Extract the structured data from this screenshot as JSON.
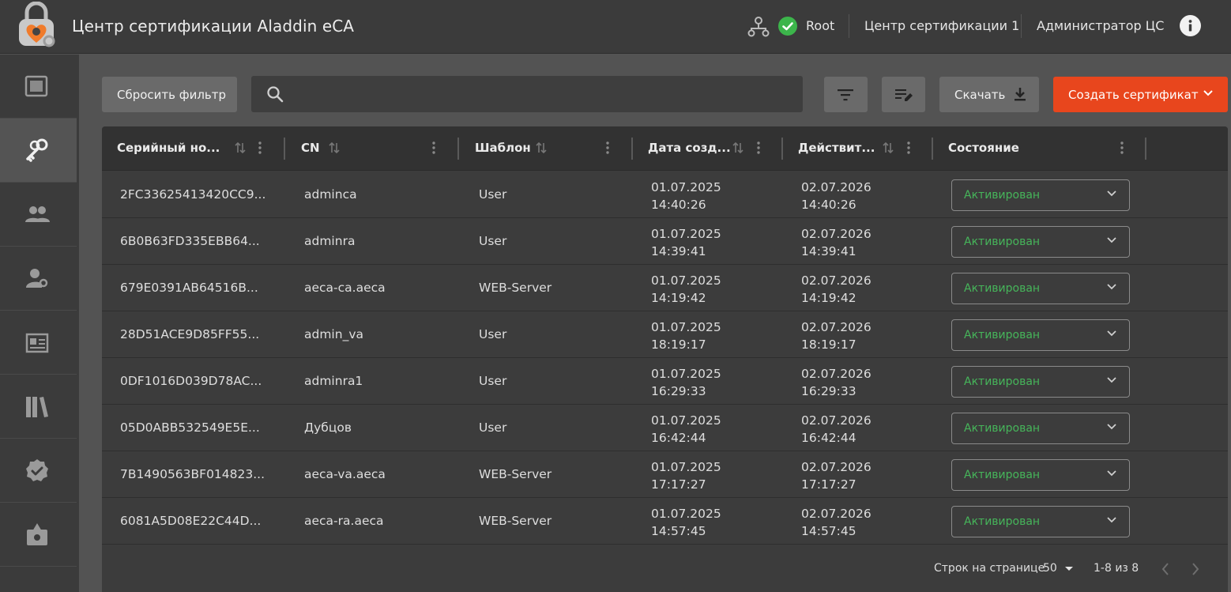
{
  "header": {
    "app_title": "Центр сертификации Aladdin eCA",
    "root_label": "Root",
    "ca_label": "Центр сертификации 1",
    "user_label": "Администратор ЦС"
  },
  "toolbar": {
    "reset_filter": "Сбросить фильтр",
    "search_placeholder": "",
    "download": "Скачать",
    "create_certificate": "Создать сертификат"
  },
  "table": {
    "columns": [
      "Серийный но...",
      "CN",
      "Шаблон",
      "Дата созд...",
      "Действит...",
      "Состояние"
    ],
    "rows": [
      {
        "serial": "2FC33625413420CC9...",
        "cn": "adminca",
        "template": "User",
        "created_date": "01.07.2025",
        "created_time": "14:40:26",
        "valid_date": "02.07.2026",
        "valid_time": "14:40:26",
        "status": "Активирован"
      },
      {
        "serial": "6B0B63FD335EBB64...",
        "cn": "adminra",
        "template": "User",
        "created_date": "01.07.2025",
        "created_time": "14:39:41",
        "valid_date": "02.07.2026",
        "valid_time": "14:39:41",
        "status": "Активирован"
      },
      {
        "serial": "679E0391AB64516B...",
        "cn": "aeca-ca.aeca",
        "template": "WEB-Server",
        "created_date": "01.07.2025",
        "created_time": "14:19:42",
        "valid_date": "02.07.2026",
        "valid_time": "14:19:42",
        "status": "Активирован"
      },
      {
        "serial": "28D51ACE9D85FF55...",
        "cn": "admin_va",
        "template": "User",
        "created_date": "01.07.2025",
        "created_time": "18:19:17",
        "valid_date": "02.07.2026",
        "valid_time": "18:19:17",
        "status": "Активирован"
      },
      {
        "serial": "0DF1016D039D78AC...",
        "cn": "adminra1",
        "template": "User",
        "created_date": "01.07.2025",
        "created_time": "16:29:33",
        "valid_date": "02.07.2026",
        "valid_time": "16:29:33",
        "status": "Активирован"
      },
      {
        "serial": "05D0ABB532549E5E...",
        "cn": "Дубцов",
        "template": "User",
        "created_date": "01.07.2025",
        "created_time": "16:42:44",
        "valid_date": "02.07.2026",
        "valid_time": "16:42:44",
        "status": "Активирован"
      },
      {
        "serial": "7B1490563BF014823...",
        "cn": "aeca-va.aeca",
        "template": "WEB-Server",
        "created_date": "01.07.2025",
        "created_time": "17:17:27",
        "valid_date": "02.07.2026",
        "valid_time": "17:17:27",
        "status": "Активирован"
      },
      {
        "serial": "6081A5D08E22C44D...",
        "cn": "aeca-ra.aeca",
        "template": "WEB-Server",
        "created_date": "01.07.2025",
        "created_time": "14:57:45",
        "valid_date": "02.07.2026",
        "valid_time": "14:57:45",
        "status": "Активирован"
      }
    ]
  },
  "footer": {
    "rows_per_page_label": "Строк на странице",
    "rows_per_page": "50",
    "range": "1-8 из 8"
  },
  "sidebar": {
    "items": [
      "dashboard-icon",
      "certificates-key-icon",
      "users-icon",
      "user-key-icon",
      "registry-icon",
      "library-icon",
      "verified-icon",
      "settings-icon"
    ],
    "active_index": 1
  },
  "colors": {
    "accent": "#e8461d",
    "status_ok": "#46b55a",
    "header_bg": "#3b3b3b",
    "page_bg": "#535353"
  }
}
